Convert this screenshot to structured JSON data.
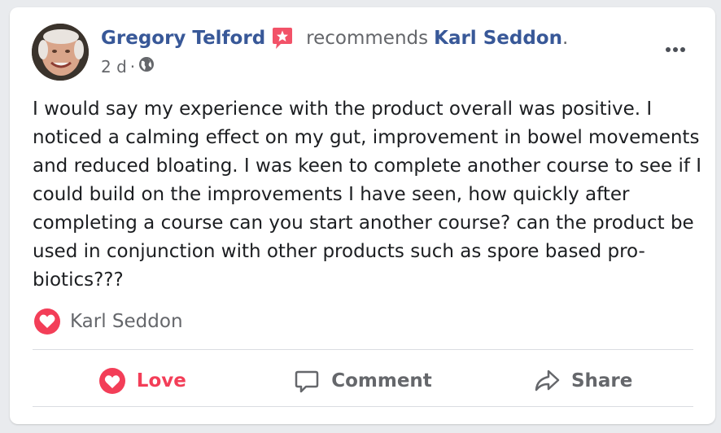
{
  "post": {
    "author": "Gregory Telford",
    "action_text": "recommends",
    "page_name": "Karl Seddon",
    "period": ".",
    "time": "2 d",
    "separator": "·",
    "privacy_icon": "globe-icon",
    "badge_icon": "recommend-star-icon",
    "body": "I would say my experience with the product overall was positive. I noticed a calming effect on my gut, improvement in bowel movements and reduced bloating. I was keen to complete another course to see if I could build on the improvements I have seen, how quickly after completing a course can you start another course? can the product be used in conjunction with other products such as spore based pro-biotics???"
  },
  "reactions": {
    "icon": "heart-icon",
    "names": "Karl Seddon"
  },
  "actions": [
    {
      "label": "Love",
      "icon": "heart-icon",
      "active": true
    },
    {
      "label": "Comment",
      "icon": "comment-icon"
    },
    {
      "label": "Share",
      "icon": "share-icon"
    }
  ],
  "colors": {
    "link": "#385898",
    "love": "#f33e58",
    "muted": "#65676b",
    "badge": "#f25268"
  }
}
